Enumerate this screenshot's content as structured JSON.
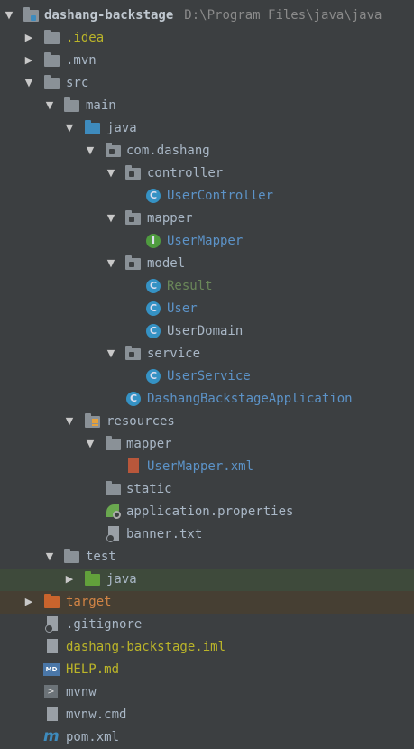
{
  "project": {
    "name": "dashang-backstage",
    "path": "D:\\Program Files\\java\\java"
  },
  "tree": {
    "idea": ".idea",
    "mvn": ".mvn",
    "src": "src",
    "main": "main",
    "java": "java",
    "pkg": "com.dashang",
    "controller": "controller",
    "UserController": "UserController",
    "mapper": "mapper",
    "UserMapper": "UserMapper",
    "model": "model",
    "Result": "Result",
    "User": "User",
    "UserDomain": "UserDomain",
    "service": "service",
    "UserService": "UserService",
    "app": "DashangBackstageApplication",
    "resources": "resources",
    "res_mapper": "mapper",
    "UserMapperXml": "UserMapper.xml",
    "static": "static",
    "appProps": "application.properties",
    "banner": "banner.txt",
    "test": "test",
    "test_java": "java",
    "target": "target",
    "gitignore": ".gitignore",
    "iml": "dashang-backstage.iml",
    "help": "HELP.md",
    "mvnw": "mvnw",
    "mvnwcmd": "mvnw.cmd",
    "pom": "pom.xml"
  },
  "icons": {
    "class": "C",
    "interface": "I",
    "md": "MD",
    "maven": "m",
    "terminal": ">"
  },
  "colors": {
    "background": "#3c3f41",
    "selected_test_row": "#3e4a3b",
    "excluded_row": "#463f33",
    "source_folder": "#3e8bbd",
    "excluded_folder": "#c9642d",
    "test_folder": "#62a13b"
  }
}
